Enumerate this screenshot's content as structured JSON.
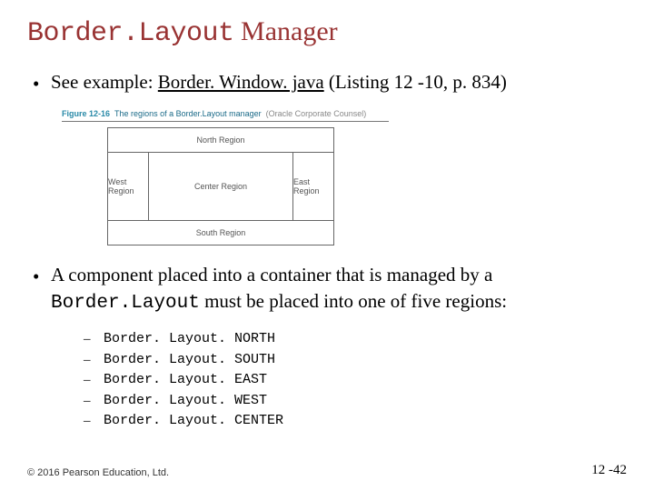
{
  "title": {
    "code_part": "Border.Layout",
    "text_part": " Manager"
  },
  "bullet1": {
    "prefix": "See example: ",
    "link": "Border. Window. java",
    "suffix": " (Listing 12 -10, p. 834)"
  },
  "figure": {
    "num": "Figure 12-16",
    "title": "The regions of a Border.Layout manager",
    "sub": "(Oracle Corporate Counsel)",
    "regions": {
      "north": "North Region",
      "south": "South Region",
      "west": "West Region",
      "east": "East Region",
      "center": "Center Region"
    }
  },
  "bullet2": {
    "line1": "A component placed into a container that is managed by a ",
    "code": "Border.Layout",
    "line2": " must be placed into one of five regions:"
  },
  "constants": [
    "Border. Layout. NORTH",
    "Border. Layout. SOUTH",
    "Border. Layout. EAST",
    "Border. Layout. WEST",
    "Border. Layout. CENTER"
  ],
  "footer": {
    "copyright": "© 2016 Pearson Education, Ltd.",
    "page": "12 -42"
  }
}
